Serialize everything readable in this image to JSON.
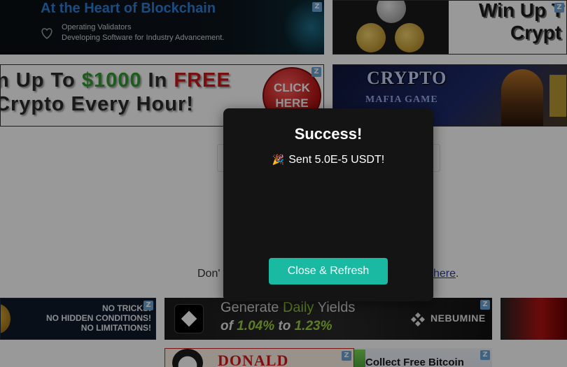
{
  "banners": {
    "blockchain": {
      "title": "At the Heart of Blockchain",
      "line1": "Operating Validators",
      "line2": "Developing Software for Industry Advancement.",
      "badge": "Z"
    },
    "win_crypto": {
      "line1": "Win Up T",
      "line2": "Crypt",
      "badge": "Z"
    },
    "free_crypto": {
      "l1_pre": "n Up To ",
      "l1_amount": "$1000",
      "l1_mid": " In ",
      "l1_free": "FREE",
      "l2": "Crypto Every Hour!",
      "click1": "CLICK",
      "click2": "HERE",
      "badge": "Z"
    },
    "mafia_game": {
      "title": "CRYPTO",
      "subtitle": "MAFIA GAME"
    },
    "no_tricks": {
      "line1": "NO TRICKS!",
      "line2": "NO HIDDEN CONDITIONS!",
      "line3": "NO LIMITATIONS!",
      "badge": "Z"
    },
    "nebumine": {
      "gen_pre": "Generate ",
      "gen_hl": "Daily",
      "gen_post": " Yields",
      "yield_pre": "of ",
      "yield_a": "1.04%",
      "yield_mid": " to ",
      "yield_b": "1.23%",
      "brand": "NEBUMINE",
      "badge": "Z"
    },
    "donald": {
      "text": "DONALD",
      "badge": "Z"
    },
    "collect": {
      "text": "Collect Free Bitcoin",
      "badge": "Z"
    }
  },
  "page": {
    "text_left": "Don'",
    "link_text": "here",
    "text_right_end": "."
  },
  "modal": {
    "title": "Success!",
    "emoji": "🎉",
    "message": "Sent 5.0E-5 USDT!",
    "button": "Close & Refresh"
  },
  "colors": {
    "button": "#19b9a2",
    "modal_bg": "#141414",
    "link": "#2a3c9b",
    "accent_green": "#2f9a2f",
    "accent_red": "#c91818"
  }
}
